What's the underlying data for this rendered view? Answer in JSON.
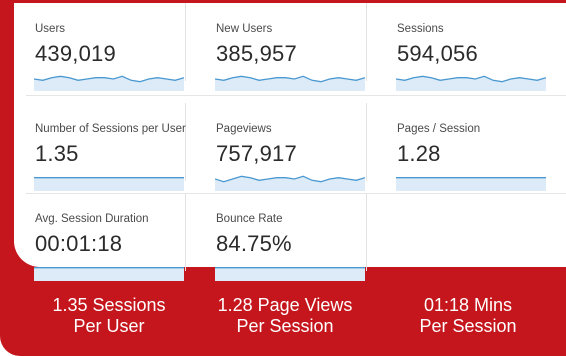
{
  "metrics": [
    {
      "label": "Users",
      "value": "439,019",
      "trend": [
        6,
        5,
        7,
        8,
        7,
        5,
        6,
        7,
        7,
        6,
        8,
        5,
        4,
        6,
        7,
        6,
        5,
        7
      ]
    },
    {
      "label": "New Users",
      "value": "385,957",
      "trend": [
        6,
        5,
        7,
        8,
        7,
        5,
        6,
        7,
        7,
        6,
        8,
        5,
        4,
        6,
        7,
        6,
        5,
        7
      ]
    },
    {
      "label": "Sessions",
      "value": "594,056",
      "trend": [
        6,
        5,
        7,
        8,
        7,
        5,
        6,
        7,
        7,
        6,
        8,
        5,
        4,
        6,
        7,
        6,
        5,
        7
      ]
    },
    {
      "label": "Number of Sessions per User",
      "value": "1.35",
      "trend": [
        7,
        7,
        7,
        7,
        7,
        7,
        7,
        7,
        7,
        7,
        7,
        7,
        7,
        7,
        7,
        7,
        7,
        7
      ]
    },
    {
      "label": "Pageviews",
      "value": "757,917",
      "trend": [
        6,
        4,
        6,
        8,
        7,
        5,
        6,
        7,
        7,
        6,
        8,
        5,
        4,
        6,
        7,
        6,
        5,
        7
      ]
    },
    {
      "label": "Pages / Session",
      "value": "1.28",
      "trend": [
        7,
        7,
        7,
        7,
        7,
        7,
        7,
        7,
        7,
        7,
        7,
        7,
        7,
        7,
        7,
        7,
        7,
        7
      ]
    },
    {
      "label": "Avg. Session Duration",
      "value": "00:01:18",
      "trend": [
        7,
        7,
        7,
        7,
        7,
        7,
        7,
        7,
        7,
        7,
        7,
        7,
        7,
        7,
        7,
        7,
        7,
        7
      ]
    },
    {
      "label": "Bounce Rate",
      "value": "84.75%",
      "trend": [
        7,
        7,
        7,
        7,
        7,
        7,
        7,
        7,
        7,
        7,
        7,
        7,
        7,
        7,
        7,
        7,
        7,
        7
      ]
    }
  ],
  "banner": {
    "stats": [
      {
        "line1": "1.35 Sessions",
        "line2": "Per User"
      },
      {
        "line1": "1.28 Page Views",
        "line2": "Per Session"
      },
      {
        "line1": "01:18 Mins",
        "line2": "Per Session"
      }
    ]
  },
  "colors": {
    "brand_red": "#c4161c",
    "sparkline": "#4a98d0",
    "sparkline_fill": "#dcebf7"
  }
}
